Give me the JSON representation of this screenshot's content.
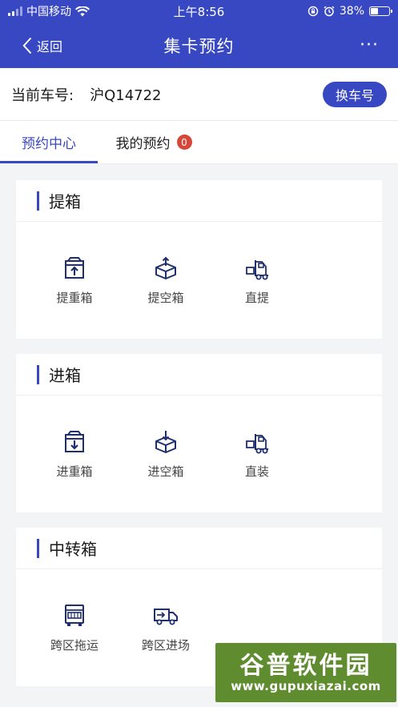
{
  "status_bar": {
    "carrier": "中国移动",
    "time": "上午8:56",
    "battery": "38%"
  },
  "nav": {
    "back_label": "返回",
    "title": "集卡预约",
    "more_label": "···"
  },
  "plate": {
    "label": "当前车号:",
    "value": "沪Q14722",
    "change_label": "换车号"
  },
  "tabs": [
    {
      "label": "预约中心",
      "active": true
    },
    {
      "label": "我的预约",
      "badge": "0"
    }
  ],
  "sections": [
    {
      "title": "提箱",
      "items": [
        {
          "label": "提重箱",
          "icon": "box-up-icon"
        },
        {
          "label": "提空箱",
          "icon": "empty-box-up-icon"
        },
        {
          "label": "直提",
          "icon": "forklift-icon"
        }
      ]
    },
    {
      "title": "进箱",
      "items": [
        {
          "label": "进重箱",
          "icon": "box-down-icon"
        },
        {
          "label": "进空箱",
          "icon": "empty-box-down-icon"
        },
        {
          "label": "直装",
          "icon": "forklift-icon"
        }
      ]
    },
    {
      "title": "中转箱",
      "items": [
        {
          "label": "跨区拖运",
          "icon": "truck-front-icon"
        },
        {
          "label": "跨区进场",
          "icon": "delivery-truck-icon"
        }
      ]
    }
  ],
  "watermark": {
    "cn": "谷普软件园",
    "url": "www.gupuxiazai.com"
  },
  "colors": {
    "brand": "#3847c2",
    "badge": "#d6473a",
    "icon_dark": "#1f2f6e"
  }
}
